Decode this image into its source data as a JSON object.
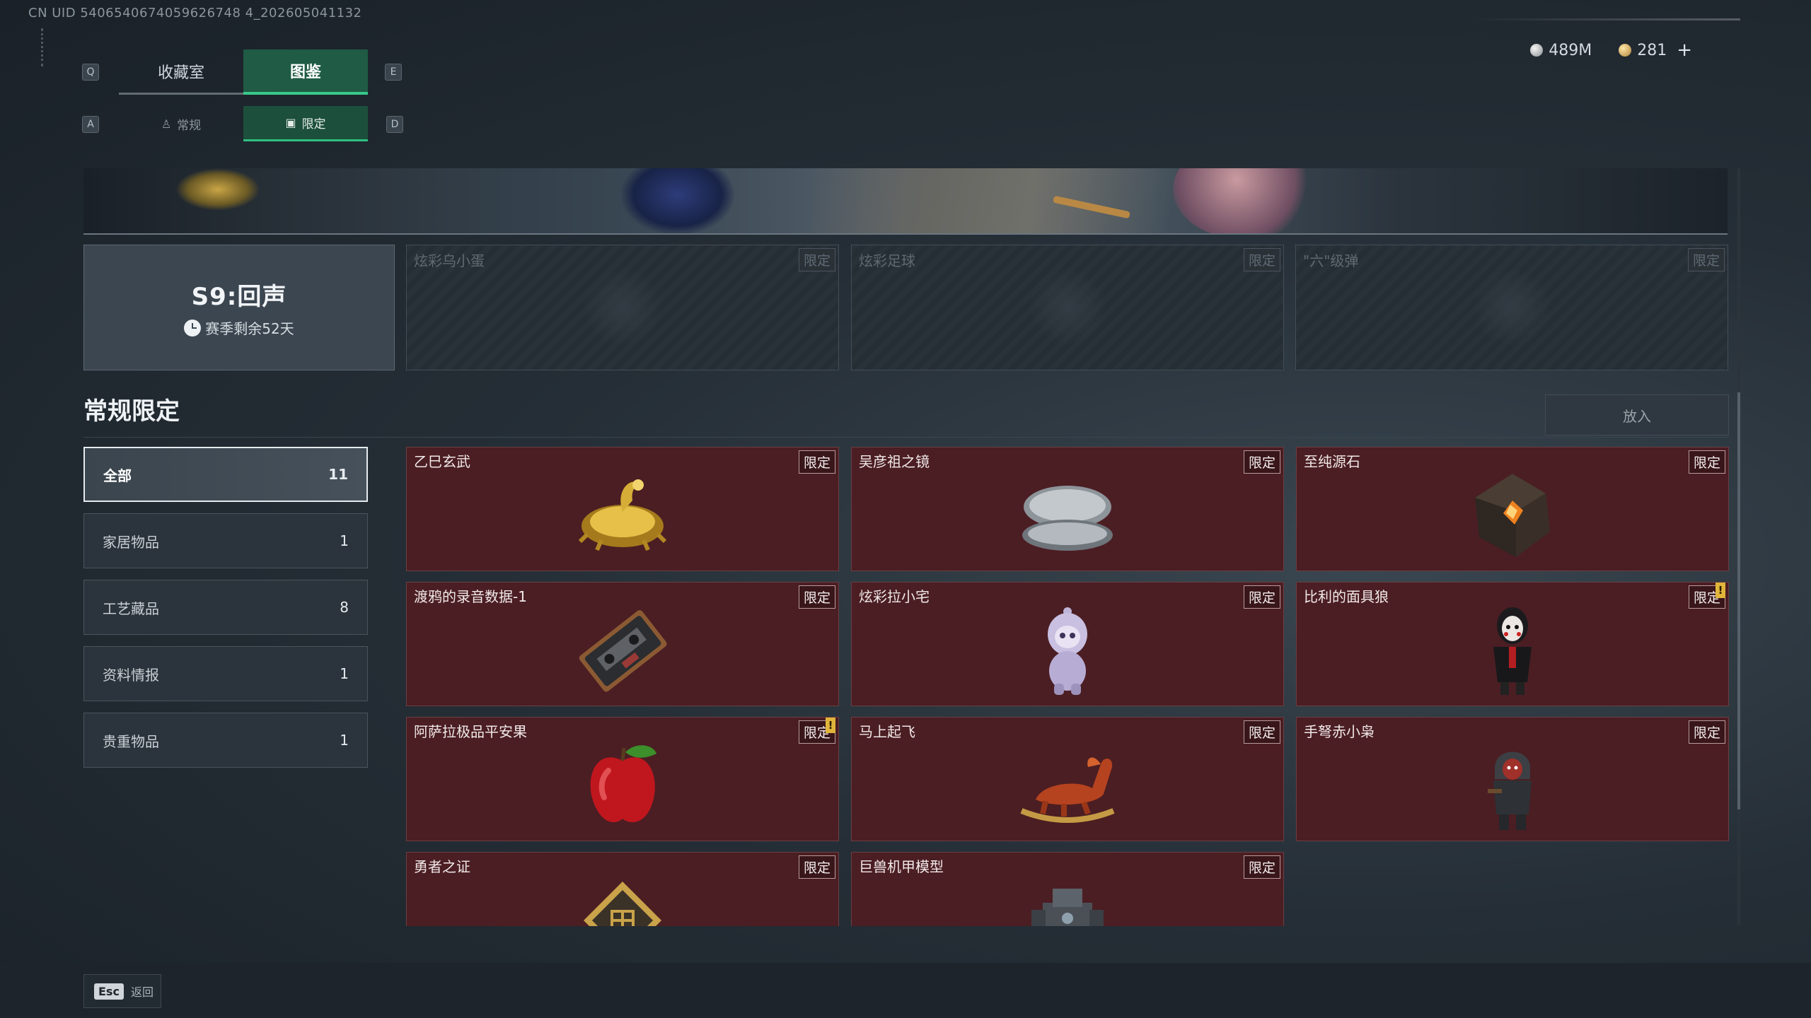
{
  "uid": "CN UID 5406540674059626748 4_202605041132",
  "keys": {
    "prev_main": "Q",
    "next_main": "E",
    "prev_sub": "A",
    "next_sub": "D"
  },
  "main_tabs": [
    {
      "label": "收藏室"
    },
    {
      "label": "图鉴",
      "active": true
    }
  ],
  "sub_tabs": [
    {
      "label": "常规"
    },
    {
      "label": "限定",
      "active": true
    }
  ],
  "currency": [
    {
      "icon": "silver-coin-icon",
      "value": "489M"
    },
    {
      "icon": "gold-coin-icon",
      "value": "281"
    }
  ],
  "season": {
    "title": "S9:回声",
    "remaining": "赛季剩余52天"
  },
  "locked_items": [
    {
      "name": "炫彩乌小蛋",
      "tag": "限定"
    },
    {
      "name": "炫彩足球",
      "tag": "限定"
    },
    {
      "name": "\"六\"级弹",
      "tag": "限定"
    }
  ],
  "section": {
    "title": "常规限定",
    "put_in": "放入"
  },
  "categories": [
    {
      "label": "全部",
      "count": "11",
      "active": true
    },
    {
      "label": "家居物品",
      "count": "1"
    },
    {
      "label": "工艺藏品",
      "count": "8"
    },
    {
      "label": "资料情报",
      "count": "1"
    },
    {
      "label": "贵重物品",
      "count": "1"
    }
  ],
  "items": [
    {
      "name": "乙巳玄武",
      "tag": "限定",
      "icon": "golden-dragon-icon"
    },
    {
      "name": "吴彦祖之镜",
      "tag": "限定",
      "icon": "compact-mirror-icon"
    },
    {
      "name": "至纯源石",
      "tag": "限定",
      "icon": "crystal-stone-icon"
    },
    {
      "name": "渡鸦的录音数据-1",
      "tag": "限定",
      "icon": "cassette-tape-icon"
    },
    {
      "name": "炫彩拉小宅",
      "tag": "限定",
      "icon": "toy-figure-icon"
    },
    {
      "name": "比利的面具狼",
      "tag": "限定",
      "icon": "puppet-doll-icon",
      "alert": "!"
    },
    {
      "name": "阿萨拉极品平安果",
      "tag": "限定",
      "icon": "red-apple-icon",
      "alert": "!"
    },
    {
      "name": "马上起飞",
      "tag": "限定",
      "icon": "rocking-horse-icon"
    },
    {
      "name": "手弩赤小枭",
      "tag": "限定",
      "icon": "hooded-figure-icon"
    },
    {
      "name": "勇者之证",
      "tag": "限定",
      "icon": "badge-emblem-icon"
    },
    {
      "name": "巨兽机甲模型",
      "tag": "限定",
      "icon": "mech-model-icon"
    }
  ],
  "footer": {
    "esc_key": "Esc",
    "back_label": "返回"
  }
}
